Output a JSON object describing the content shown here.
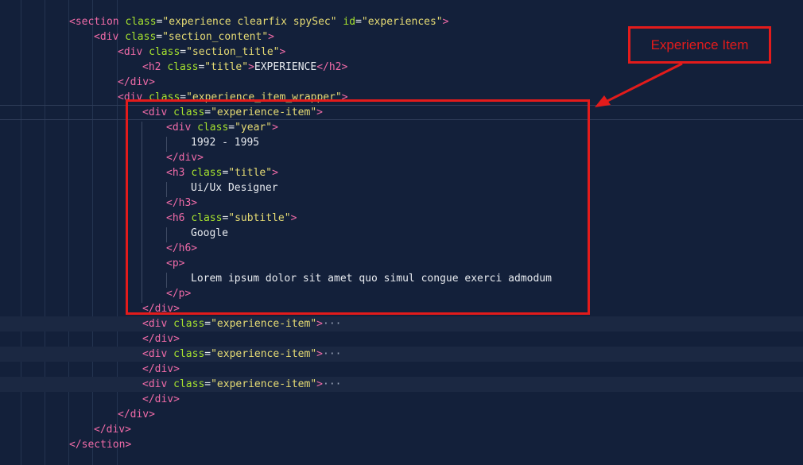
{
  "editor": {
    "lines": [
      {
        "indent": 0,
        "segments": [
          [
            "tag",
            "<section"
          ],
          [
            "txt",
            " "
          ],
          [
            "attr",
            "class"
          ],
          [
            "punc",
            "="
          ],
          [
            "str",
            "\"experience clearfix spySec\""
          ],
          [
            "txt",
            " "
          ],
          [
            "attr",
            "id"
          ],
          [
            "punc",
            "="
          ],
          [
            "str",
            "\"experiences\""
          ],
          [
            "tag",
            ">"
          ]
        ]
      },
      {
        "indent": 1,
        "segments": [
          [
            "tag",
            "<div"
          ],
          [
            "txt",
            " "
          ],
          [
            "attr",
            "class"
          ],
          [
            "punc",
            "="
          ],
          [
            "str",
            "\"section_content\""
          ],
          [
            "tag",
            ">"
          ]
        ]
      },
      {
        "indent": 2,
        "segments": [
          [
            "tag",
            "<div"
          ],
          [
            "txt",
            " "
          ],
          [
            "attr",
            "class"
          ],
          [
            "punc",
            "="
          ],
          [
            "str",
            "\"section_title\""
          ],
          [
            "tag",
            ">"
          ]
        ]
      },
      {
        "indent": 3,
        "segments": [
          [
            "tag",
            "<h2"
          ],
          [
            "txt",
            " "
          ],
          [
            "attr",
            "class"
          ],
          [
            "punc",
            "="
          ],
          [
            "str",
            "\"title\""
          ],
          [
            "tag",
            ">"
          ],
          [
            "txt",
            "EXPERIENCE"
          ],
          [
            "tag",
            "</h2>"
          ]
        ]
      },
      {
        "indent": 2,
        "segments": [
          [
            "tag",
            "</div>"
          ]
        ]
      },
      {
        "indent": 2,
        "segments": [
          [
            "tag",
            "<div"
          ],
          [
            "txt",
            " "
          ],
          [
            "attr",
            "class"
          ],
          [
            "punc",
            "="
          ],
          [
            "str",
            "\"experience_item_wrapper\""
          ],
          [
            "tag",
            ">"
          ]
        ]
      },
      {
        "indent": 3,
        "cursor": true,
        "segments": [
          [
            "tag",
            "<div"
          ],
          [
            "txt",
            " "
          ],
          [
            "attr",
            "class"
          ],
          [
            "punc",
            "="
          ],
          [
            "str",
            "\"experience-item\""
          ],
          [
            "tag",
            ">"
          ]
        ]
      },
      {
        "indent": 4,
        "segments": [
          [
            "tag",
            "<div"
          ],
          [
            "txt",
            " "
          ],
          [
            "attr",
            "class"
          ],
          [
            "punc",
            "="
          ],
          [
            "str",
            "\"year\""
          ],
          [
            "tag",
            ">"
          ]
        ]
      },
      {
        "indent": 5,
        "segments": [
          [
            "txt",
            "1992 - 1995"
          ]
        ]
      },
      {
        "indent": 4,
        "segments": [
          [
            "tag",
            "</div>"
          ]
        ]
      },
      {
        "indent": 4,
        "segments": [
          [
            "tag",
            "<h3"
          ],
          [
            "txt",
            " "
          ],
          [
            "attr",
            "class"
          ],
          [
            "punc",
            "="
          ],
          [
            "str",
            "\"title\""
          ],
          [
            "tag",
            ">"
          ]
        ]
      },
      {
        "indent": 5,
        "segments": [
          [
            "txt",
            "Ui/Ux Designer"
          ]
        ]
      },
      {
        "indent": 4,
        "segments": [
          [
            "tag",
            "</h3>"
          ]
        ]
      },
      {
        "indent": 4,
        "segments": [
          [
            "tag",
            "<h6"
          ],
          [
            "txt",
            " "
          ],
          [
            "attr",
            "class"
          ],
          [
            "punc",
            "="
          ],
          [
            "str",
            "\"subtitle\""
          ],
          [
            "tag",
            ">"
          ]
        ]
      },
      {
        "indent": 5,
        "segments": [
          [
            "txt",
            "Google"
          ]
        ]
      },
      {
        "indent": 4,
        "segments": [
          [
            "tag",
            "</h6>"
          ]
        ]
      },
      {
        "indent": 4,
        "segments": [
          [
            "tag",
            "<p>"
          ]
        ]
      },
      {
        "indent": 5,
        "segments": [
          [
            "txt",
            "Lorem ipsum dolor sit amet quo simul congue exerci admodum"
          ]
        ]
      },
      {
        "indent": 4,
        "segments": [
          [
            "tag",
            "</p>"
          ]
        ]
      },
      {
        "indent": 3,
        "segments": [
          [
            "tag",
            "</div>"
          ]
        ]
      },
      {
        "indent": 3,
        "folded": true,
        "segments": [
          [
            "tag",
            "<div"
          ],
          [
            "txt",
            " "
          ],
          [
            "attr",
            "class"
          ],
          [
            "punc",
            "="
          ],
          [
            "str",
            "\"experience-item\""
          ],
          [
            "tag",
            ">"
          ],
          [
            "dots",
            "···"
          ]
        ]
      },
      {
        "indent": 3,
        "segments": [
          [
            "tag",
            "</div>"
          ]
        ]
      },
      {
        "indent": 3,
        "folded": true,
        "segments": [
          [
            "tag",
            "<div"
          ],
          [
            "txt",
            " "
          ],
          [
            "attr",
            "class"
          ],
          [
            "punc",
            "="
          ],
          [
            "str",
            "\"experience-item\""
          ],
          [
            "tag",
            ">"
          ],
          [
            "dots",
            "···"
          ]
        ]
      },
      {
        "indent": 3,
        "segments": [
          [
            "tag",
            "</div>"
          ]
        ]
      },
      {
        "indent": 3,
        "folded": true,
        "segments": [
          [
            "tag",
            "<div"
          ],
          [
            "txt",
            " "
          ],
          [
            "attr",
            "class"
          ],
          [
            "punc",
            "="
          ],
          [
            "str",
            "\"experience-item\""
          ],
          [
            "tag",
            ">"
          ],
          [
            "dots",
            "···"
          ]
        ]
      },
      {
        "indent": 3,
        "segments": [
          [
            "tag",
            "</div>"
          ]
        ]
      },
      {
        "indent": 2,
        "segments": [
          [
            "tag",
            "</div>"
          ]
        ]
      },
      {
        "indent": 1,
        "segments": [
          [
            "tag",
            "</div>"
          ]
        ]
      },
      {
        "indent": 0,
        "segments": [
          [
            "tag",
            "</section>"
          ]
        ]
      }
    ]
  },
  "annotation": {
    "label": "Experience Item",
    "color": "#e31b1b"
  },
  "colors": {
    "background": "#13203a",
    "tag": "#f06ba8",
    "attribute": "#a6e22e",
    "string": "#e6db74",
    "text": "#e8ebf0"
  }
}
